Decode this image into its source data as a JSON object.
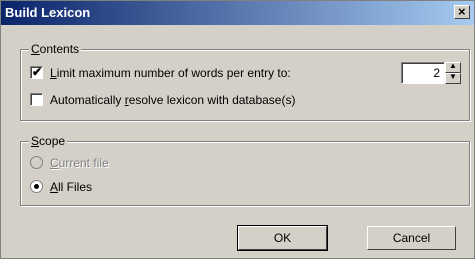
{
  "window": {
    "title": "Build Lexicon",
    "close_glyph": "×"
  },
  "contents": {
    "legend_first": "C",
    "legend_rest": "ontents",
    "limit": {
      "checked": true,
      "pre": "",
      "mnemonic": "L",
      "post": "imit maximum number of words per entry to:"
    },
    "resolve": {
      "checked": false,
      "pre": "Automatically ",
      "mnemonic": "r",
      "post": "esolve lexicon with database(s)"
    },
    "max_words": "2"
  },
  "scope": {
    "legend_first": "S",
    "legend_rest": "cope",
    "current_file": {
      "selected": false,
      "disabled": true,
      "mnemonic": "C",
      "post": "urrent file"
    },
    "all_files": {
      "selected": true,
      "disabled": false,
      "mnemonic": "A",
      "post": "ll Files"
    }
  },
  "buttons": {
    "ok": "OK",
    "cancel": "Cancel"
  },
  "icons": {
    "check": "✔",
    "spin_up": "▲",
    "spin_down": "▼"
  }
}
